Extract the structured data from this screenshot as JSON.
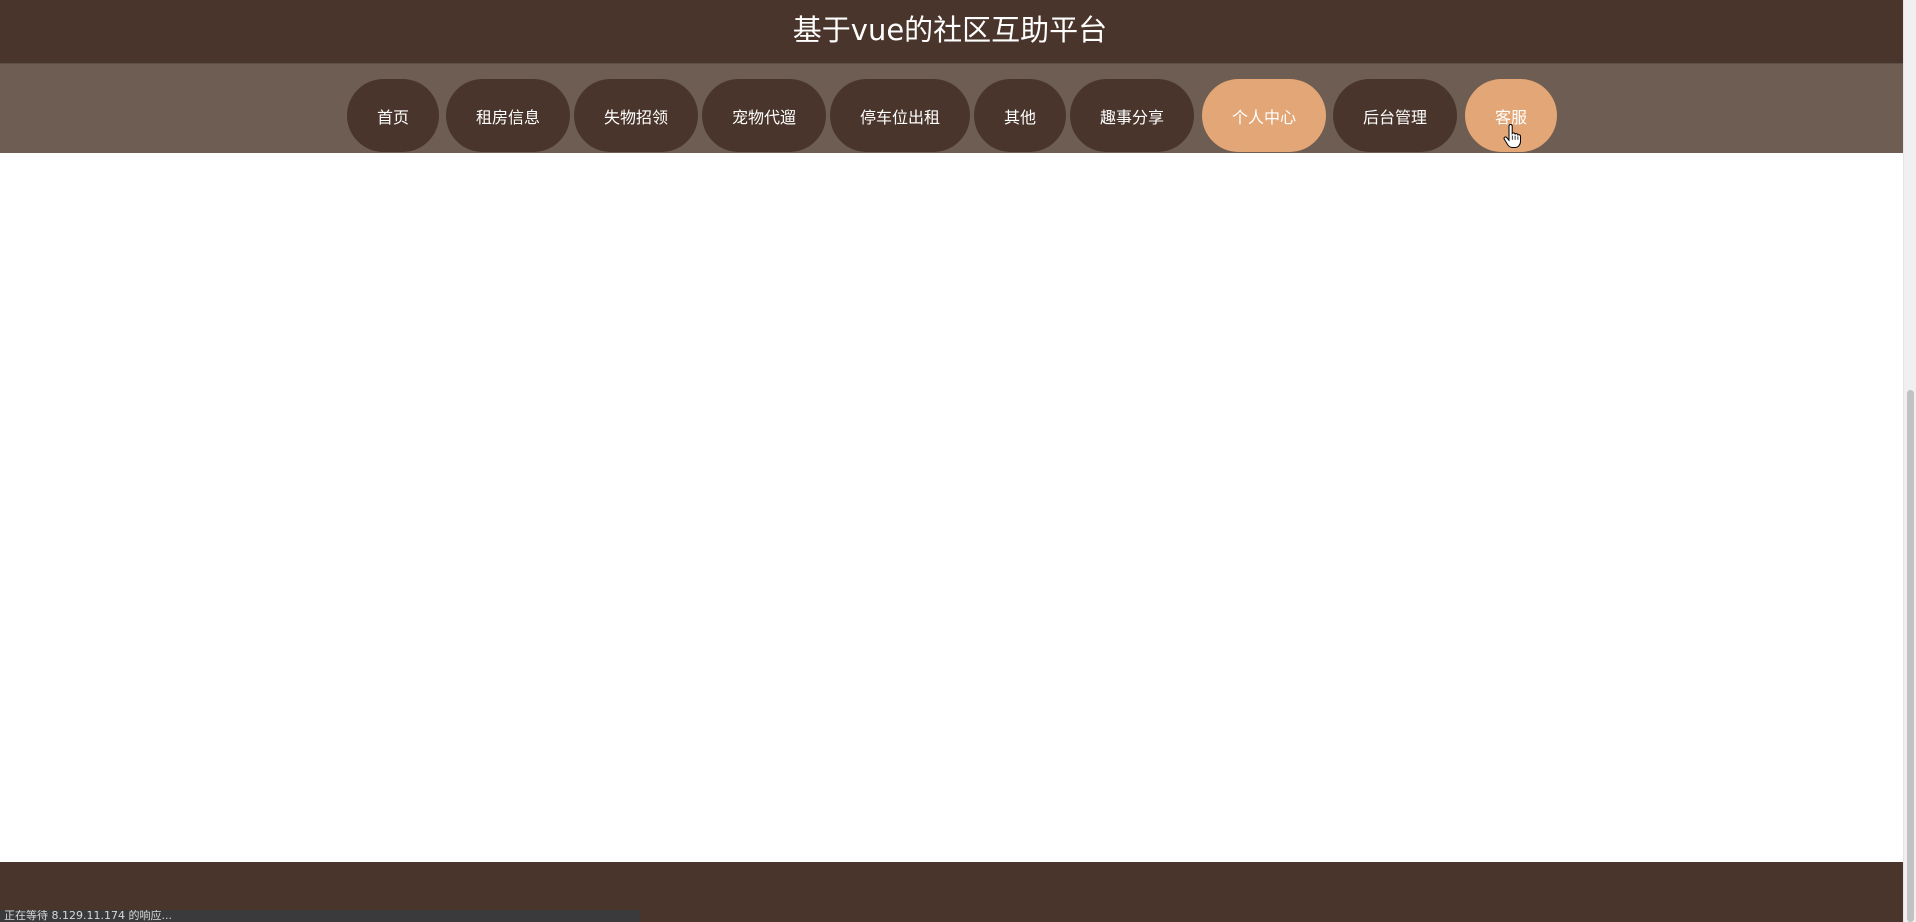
{
  "header": {
    "title": "基于vue的社区互助平台"
  },
  "nav": {
    "items": [
      {
        "label": "首页"
      },
      {
        "label": "租房信息"
      },
      {
        "label": "失物招领"
      },
      {
        "label": "宠物代遛"
      },
      {
        "label": "停车位出租"
      },
      {
        "label": "其他"
      },
      {
        "label": "趣事分享"
      },
      {
        "label": "个人中心",
        "highlighted": true
      },
      {
        "label": "后台管理"
      },
      {
        "label": "客服",
        "highlighted": true,
        "hovered": true
      }
    ]
  },
  "status_bar": {
    "text": "正在等待 8.129.11.174 的响应..."
  },
  "colors": {
    "header_bg": "#49352b",
    "nav_bg": "#6e5d52",
    "nav_item_bg": "#49352b",
    "nav_item_active_bg": "#e3a677",
    "text": "#ffffff"
  },
  "icons": {
    "cursor": "hand-pointer-cursor-icon"
  }
}
